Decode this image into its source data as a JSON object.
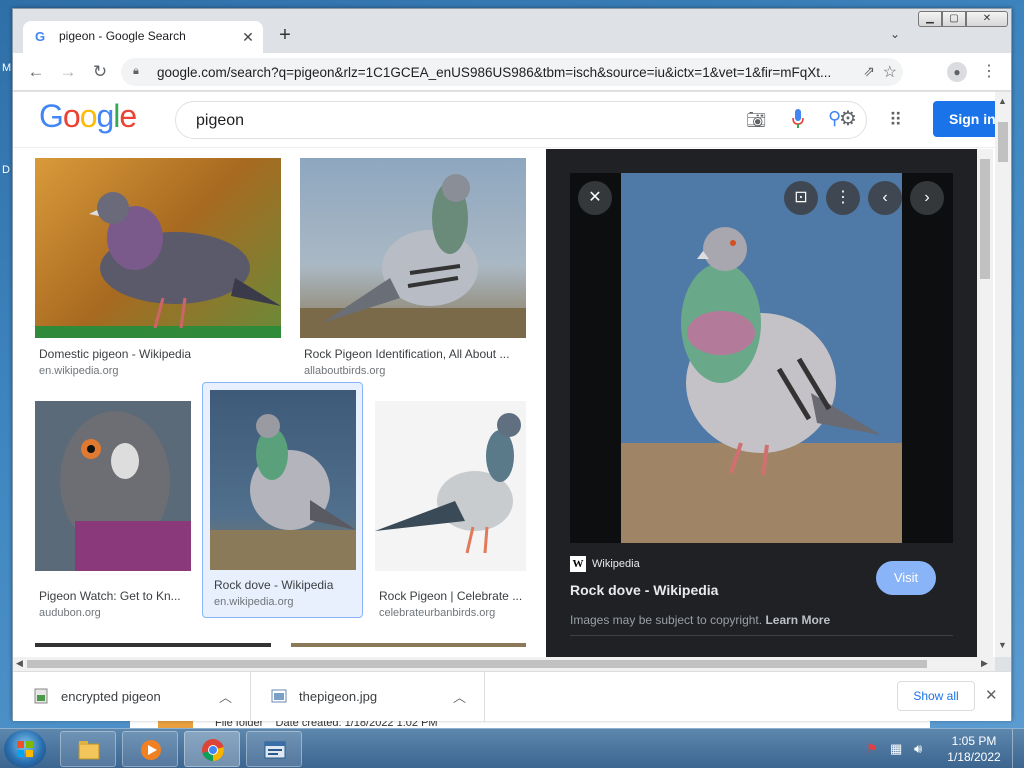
{
  "browser": {
    "tab_title": "pigeon - Google Search",
    "url": "google.com/search?q=pigeon&rlz=1C1GCEA_enUS986US986&tbm=isch&source=iu&ictx=1&vet=1&fir=mFqXt...",
    "window_min": "▁",
    "window_max": "▢",
    "window_close": "✕"
  },
  "google": {
    "logo": [
      "G",
      "o",
      "o",
      "g",
      "l",
      "e"
    ],
    "logo_colors": [
      "#4285f4",
      "#ea4335",
      "#fbbc05",
      "#4285f4",
      "#34a853",
      "#ea4335"
    ],
    "query": "pigeon",
    "signin_label": "Sign in"
  },
  "results": [
    {
      "caption": "Domestic pigeon - Wikipedia",
      "source": "en.wikipedia.org"
    },
    {
      "caption": "Rock Pigeon Identification, All About ...",
      "source": "allaboutbirds.org"
    },
    {
      "caption": "Pigeon Watch: Get to Kn...",
      "source": "audubon.org"
    },
    {
      "caption": "Rock dove - Wikipedia",
      "source": "en.wikipedia.org"
    },
    {
      "caption": "Rock Pigeon | Celebrate ...",
      "source": "celebrateurbanbirds.org"
    }
  ],
  "panel": {
    "source_name": "Wikipedia",
    "source_logo": "W",
    "title": "Rock dove - Wikipedia",
    "visit_label": "Visit",
    "copyright_text": "Images may be subject to copyright.",
    "learn_more": "Learn More"
  },
  "downloads": {
    "items": [
      {
        "name": "encrypted pigeon"
      },
      {
        "name": "thepigeon.jpg"
      }
    ],
    "show_all_label": "Show all"
  },
  "explorer_behind": {
    "text": "File folder    Date created: 1/18/2022 1:02 PM"
  },
  "desktop_fragments": [
    "M",
    "D"
  ],
  "taskbar": {
    "time": "1:05 PM",
    "date": "1/18/2022"
  },
  "colors": {
    "accent": "#1a73e8",
    "panel_bg": "#202124",
    "visit_btn": "#8ab4f8"
  }
}
